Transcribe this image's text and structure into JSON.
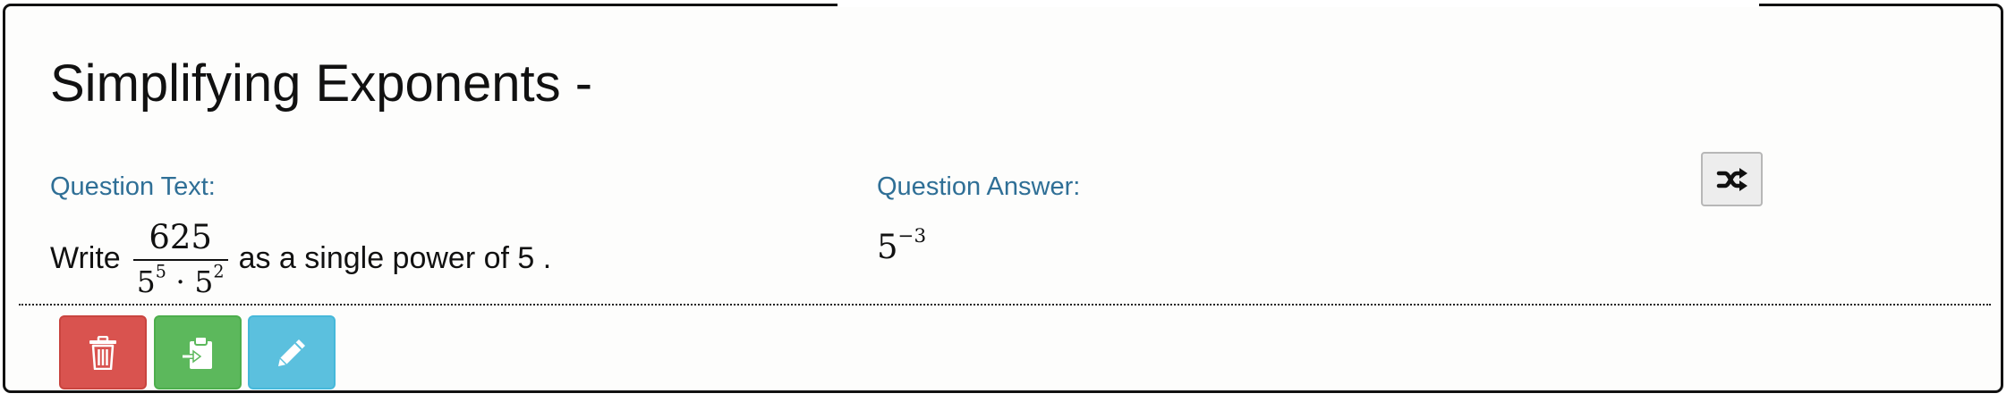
{
  "title": "Simplifying Exponents -",
  "question": {
    "label": "Question Text:",
    "prefix": "Write",
    "fraction": {
      "numerator": "625",
      "denominator": {
        "base1": "5",
        "exp1": "5",
        "operator": "·",
        "base2": "5",
        "exp2": "2"
      }
    },
    "suffix": "as a single power of 5 ."
  },
  "answer": {
    "label": "Question Answer:",
    "base": "5",
    "exponent": "−3"
  },
  "icons": {
    "shuffle": "shuffle-icon",
    "delete": "trash-icon",
    "copy": "clipboard-import-icon",
    "edit": "pencil-icon"
  },
  "colors": {
    "label": "#2f6f96",
    "delete": "#d9534f",
    "copy": "#5cb85c",
    "edit": "#5bc0de",
    "shuffle_bg": "#ededed"
  }
}
